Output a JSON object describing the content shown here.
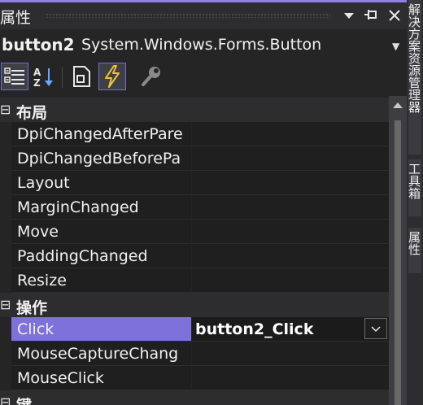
{
  "panel": {
    "title": "属性",
    "object_name": "button2",
    "object_type": "System.Windows.Forms.Button"
  },
  "toolbar": {
    "buttons": [
      {
        "name": "categorized-view",
        "icon": "categorized-icon",
        "selected": true
      },
      {
        "name": "alphabetical-view",
        "icon": "sort-alpha-icon",
        "selected": false
      },
      {
        "name": "properties-view",
        "icon": "properties-icon",
        "selected": false
      },
      {
        "name": "events-view",
        "icon": "lightning-icon",
        "selected": true
      },
      {
        "name": "property-pages",
        "icon": "wrench-icon",
        "selected": false
      }
    ]
  },
  "grid": {
    "categories": [
      {
        "label": "布局",
        "items": [
          {
            "name": "DpiChangedAfterPare",
            "value": ""
          },
          {
            "name": "DpiChangedBeforePa",
            "value": ""
          },
          {
            "name": "Layout",
            "value": ""
          },
          {
            "name": "MarginChanged",
            "value": ""
          },
          {
            "name": "Move",
            "value": ""
          },
          {
            "name": "PaddingChanged",
            "value": ""
          },
          {
            "name": "Resize",
            "value": ""
          }
        ]
      },
      {
        "label": "操作",
        "items": [
          {
            "name": "Click",
            "value": "button2_Click",
            "selected": true
          },
          {
            "name": "MouseCaptureChang",
            "value": ""
          },
          {
            "name": "MouseClick",
            "value": ""
          }
        ]
      },
      {
        "label": "键",
        "items": []
      }
    ]
  },
  "side_tabs": [
    {
      "label": "解决方案资源管理器"
    },
    {
      "label": "工具箱"
    },
    {
      "label": "属性"
    }
  ],
  "colors": {
    "accent": "#7d72dc",
    "background": "#252526",
    "cell": "#1f1f1f"
  }
}
